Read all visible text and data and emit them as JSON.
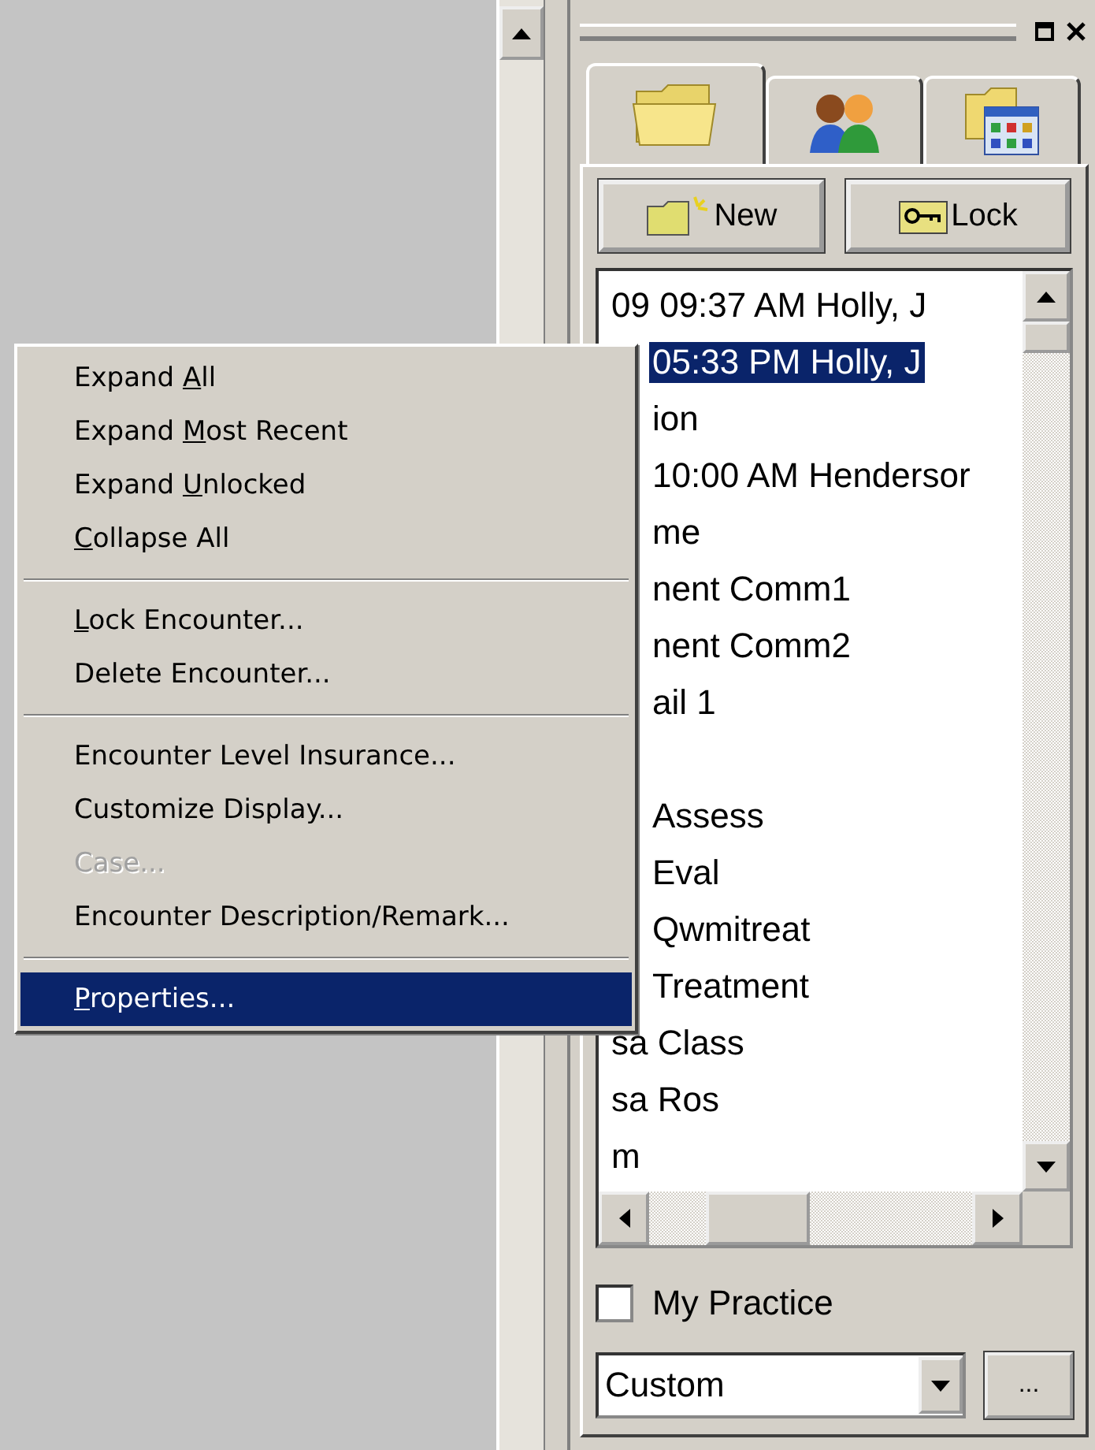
{
  "tabs": [
    {
      "kind": "folder",
      "selected": true
    },
    {
      "kind": "people",
      "selected": false
    },
    {
      "kind": "calendar",
      "selected": false
    }
  ],
  "buttons": [
    {
      "kind": "new",
      "label": "New"
    },
    {
      "kind": "lock",
      "label": "Lock"
    }
  ],
  "list_rows": [
    {
      "kind": "full",
      "text": "09 09:37 AM Holly, J",
      "selected": false
    },
    {
      "kind": "covered",
      "text": "05:33 PM Holly, J",
      "selected": true
    },
    {
      "kind": "covered",
      "text": "ion",
      "selected": false
    },
    {
      "kind": "covered",
      "text": "10:00 AM Hendersor",
      "selected": false
    },
    {
      "kind": "covered",
      "text": "me",
      "selected": false
    },
    {
      "kind": "covered",
      "text": "nent Comm1",
      "selected": false
    },
    {
      "kind": "covered",
      "text": "nent Comm2",
      "selected": false
    },
    {
      "kind": "covered",
      "text": "ail 1",
      "selected": false
    },
    {
      "kind": "blank"
    },
    {
      "kind": "covered",
      "text": "Assess",
      "selected": false
    },
    {
      "kind": "covered",
      "text": "Eval",
      "selected": false
    },
    {
      "kind": "covered",
      "text": "Qwmitreat",
      "selected": false
    },
    {
      "kind": "covered",
      "text": "Treatment",
      "selected": false
    },
    {
      "kind": "full",
      "text": "sa Class",
      "selected": false
    },
    {
      "kind": "full",
      "text": "sa Ros",
      "selected": false
    },
    {
      "kind": "full",
      "text": "m",
      "selected": false
    }
  ],
  "checkbox": {
    "label": "My Practice",
    "checked": false
  },
  "combo": {
    "value": "Custom"
  },
  "browse_button": {
    "label": "..."
  },
  "context_menu": {
    "groups": [
      {
        "items": [
          {
            "before": "Expand ",
            "key": "A",
            "after": "ll",
            "disabled": false,
            "selected": false
          },
          {
            "before": "Expand ",
            "key": "M",
            "after": "ost Recent",
            "disabled": false,
            "selected": false
          },
          {
            "before": "Expand ",
            "key": "U",
            "after": "nlocked",
            "disabled": false,
            "selected": false
          },
          {
            "key": "C",
            "after": "ollapse All",
            "disabled": false,
            "selected": false
          }
        ]
      },
      {
        "items": [
          {
            "key": "L",
            "after": "ock Encounter...",
            "disabled": false,
            "selected": false
          },
          {
            "before": "Delete Encounter...",
            "disabled": false,
            "selected": false
          }
        ]
      },
      {
        "items": [
          {
            "before": "Encounter Level Insurance...",
            "disabled": false,
            "selected": false
          },
          {
            "before": "Customize Display...",
            "disabled": false,
            "selected": false
          },
          {
            "before": "Case...",
            "disabled": true,
            "selected": false
          },
          {
            "before": "Encounter Description/Remark...",
            "disabled": false,
            "selected": false
          }
        ]
      },
      {
        "items": [
          {
            "key": "P",
            "after": "roperties...",
            "disabled": false,
            "selected": true
          }
        ]
      }
    ]
  }
}
